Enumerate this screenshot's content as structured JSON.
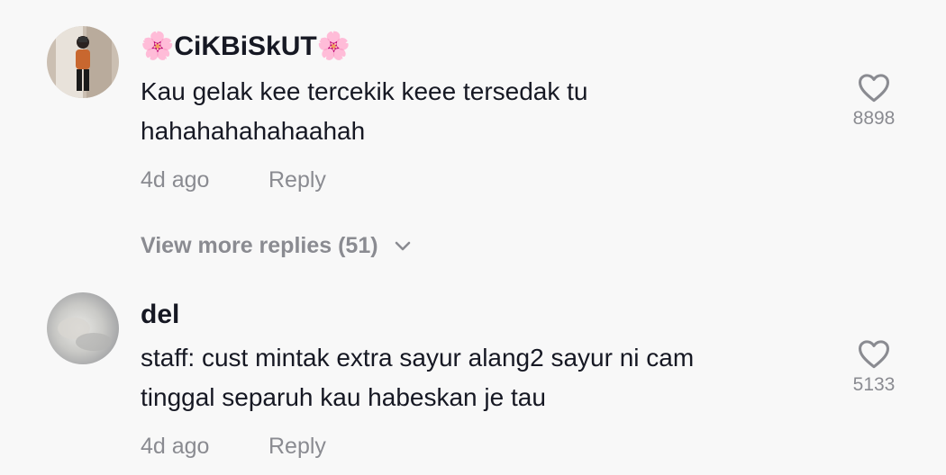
{
  "comments": [
    {
      "username_prefix": "🌸",
      "username": "CiKBiSkUT",
      "username_suffix": "🌸",
      "text_line1": "Kau gelak kee tercekik keee tersedak tu",
      "text_line2": "hahahahahahaahah",
      "time": "4d ago",
      "reply": "Reply",
      "likes": "8898",
      "view_more": "View more replies (51)"
    },
    {
      "username": "del",
      "text_line1": "staff: cust mintak extra sayur alang2 sayur ni cam",
      "text_line2": "tinggal separuh kau habeskan je tau",
      "time": "4d ago",
      "reply": "Reply",
      "likes": "5133"
    }
  ],
  "icons": {
    "like": "heart-outline-icon",
    "expand": "chevron-down-icon"
  },
  "colors": {
    "background": "#f8f8f8",
    "text": "#161823",
    "muted": "#8a8b91"
  }
}
